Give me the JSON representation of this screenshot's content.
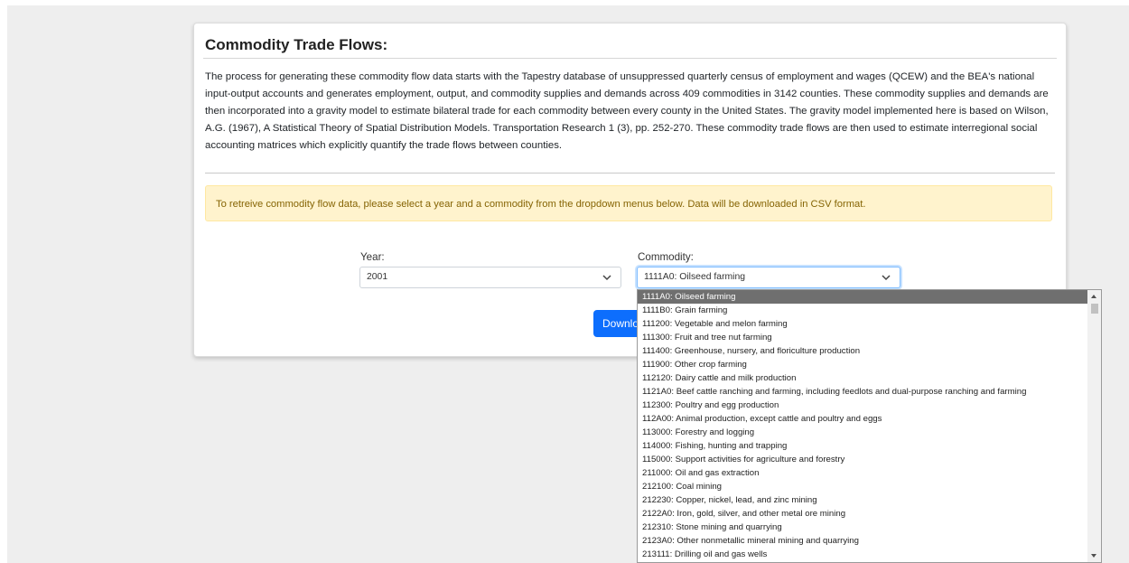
{
  "card": {
    "title": "Commodity Trade Flows:",
    "description": "The process for generating these commodity flow data starts with the Tapestry database of unsuppressed quarterly census of employment and wages (QCEW) and the BEA's national input-output accounts and generates employment, output, and commodity supplies and demands across 409 commodities in 3142 counties. These commodity supplies and demands are then incorporated into a gravity model to estimate bilateral trade for each commodity between every county in the United States. The gravity model implemented here is based on Wilson, A.G. (1967), A Statistical Theory of Spatial Distribution Models. Transportation Research 1 (3), pp. 252-270. These commodity trade flows are then used to estimate interregional social accounting matrices which explicitly quantify the trade flows between counties.",
    "alert": "To retreive commodity flow data, please select a year and a commodity from the dropdown menus below. Data will be downloaded in CSV format."
  },
  "form": {
    "year_label": "Year:",
    "year_value": "2001",
    "commodity_label": "Commodity:",
    "commodity_value": "1111A0: Oilseed farming",
    "download_label": "Download"
  },
  "dropdown": {
    "options": [
      "1111A0: Oilseed farming",
      "1111B0: Grain farming",
      "111200: Vegetable and melon farming",
      "111300: Fruit and tree nut farming",
      "111400: Greenhouse, nursery, and floriculture production",
      "111900: Other crop farming",
      "112120: Dairy cattle and milk production",
      "1121A0: Beef cattle ranching and farming, including feedlots and dual-purpose ranching and farming",
      "112300: Poultry and egg production",
      "112A00: Animal production, except cattle and poultry and eggs",
      "113000: Forestry and logging",
      "114000: Fishing, hunting and trapping",
      "115000: Support activities for agriculture and forestry",
      "211000: Oil and gas extraction",
      "212100: Coal mining",
      "212230: Copper, nickel, lead, and zinc mining",
      "2122A0: Iron, gold, silver, and other metal ore mining",
      "212310: Stone mining and quarrying",
      "2123A0: Other nonmetallic mineral mining and quarrying",
      "213111: Drilling oil and gas wells"
    ]
  }
}
